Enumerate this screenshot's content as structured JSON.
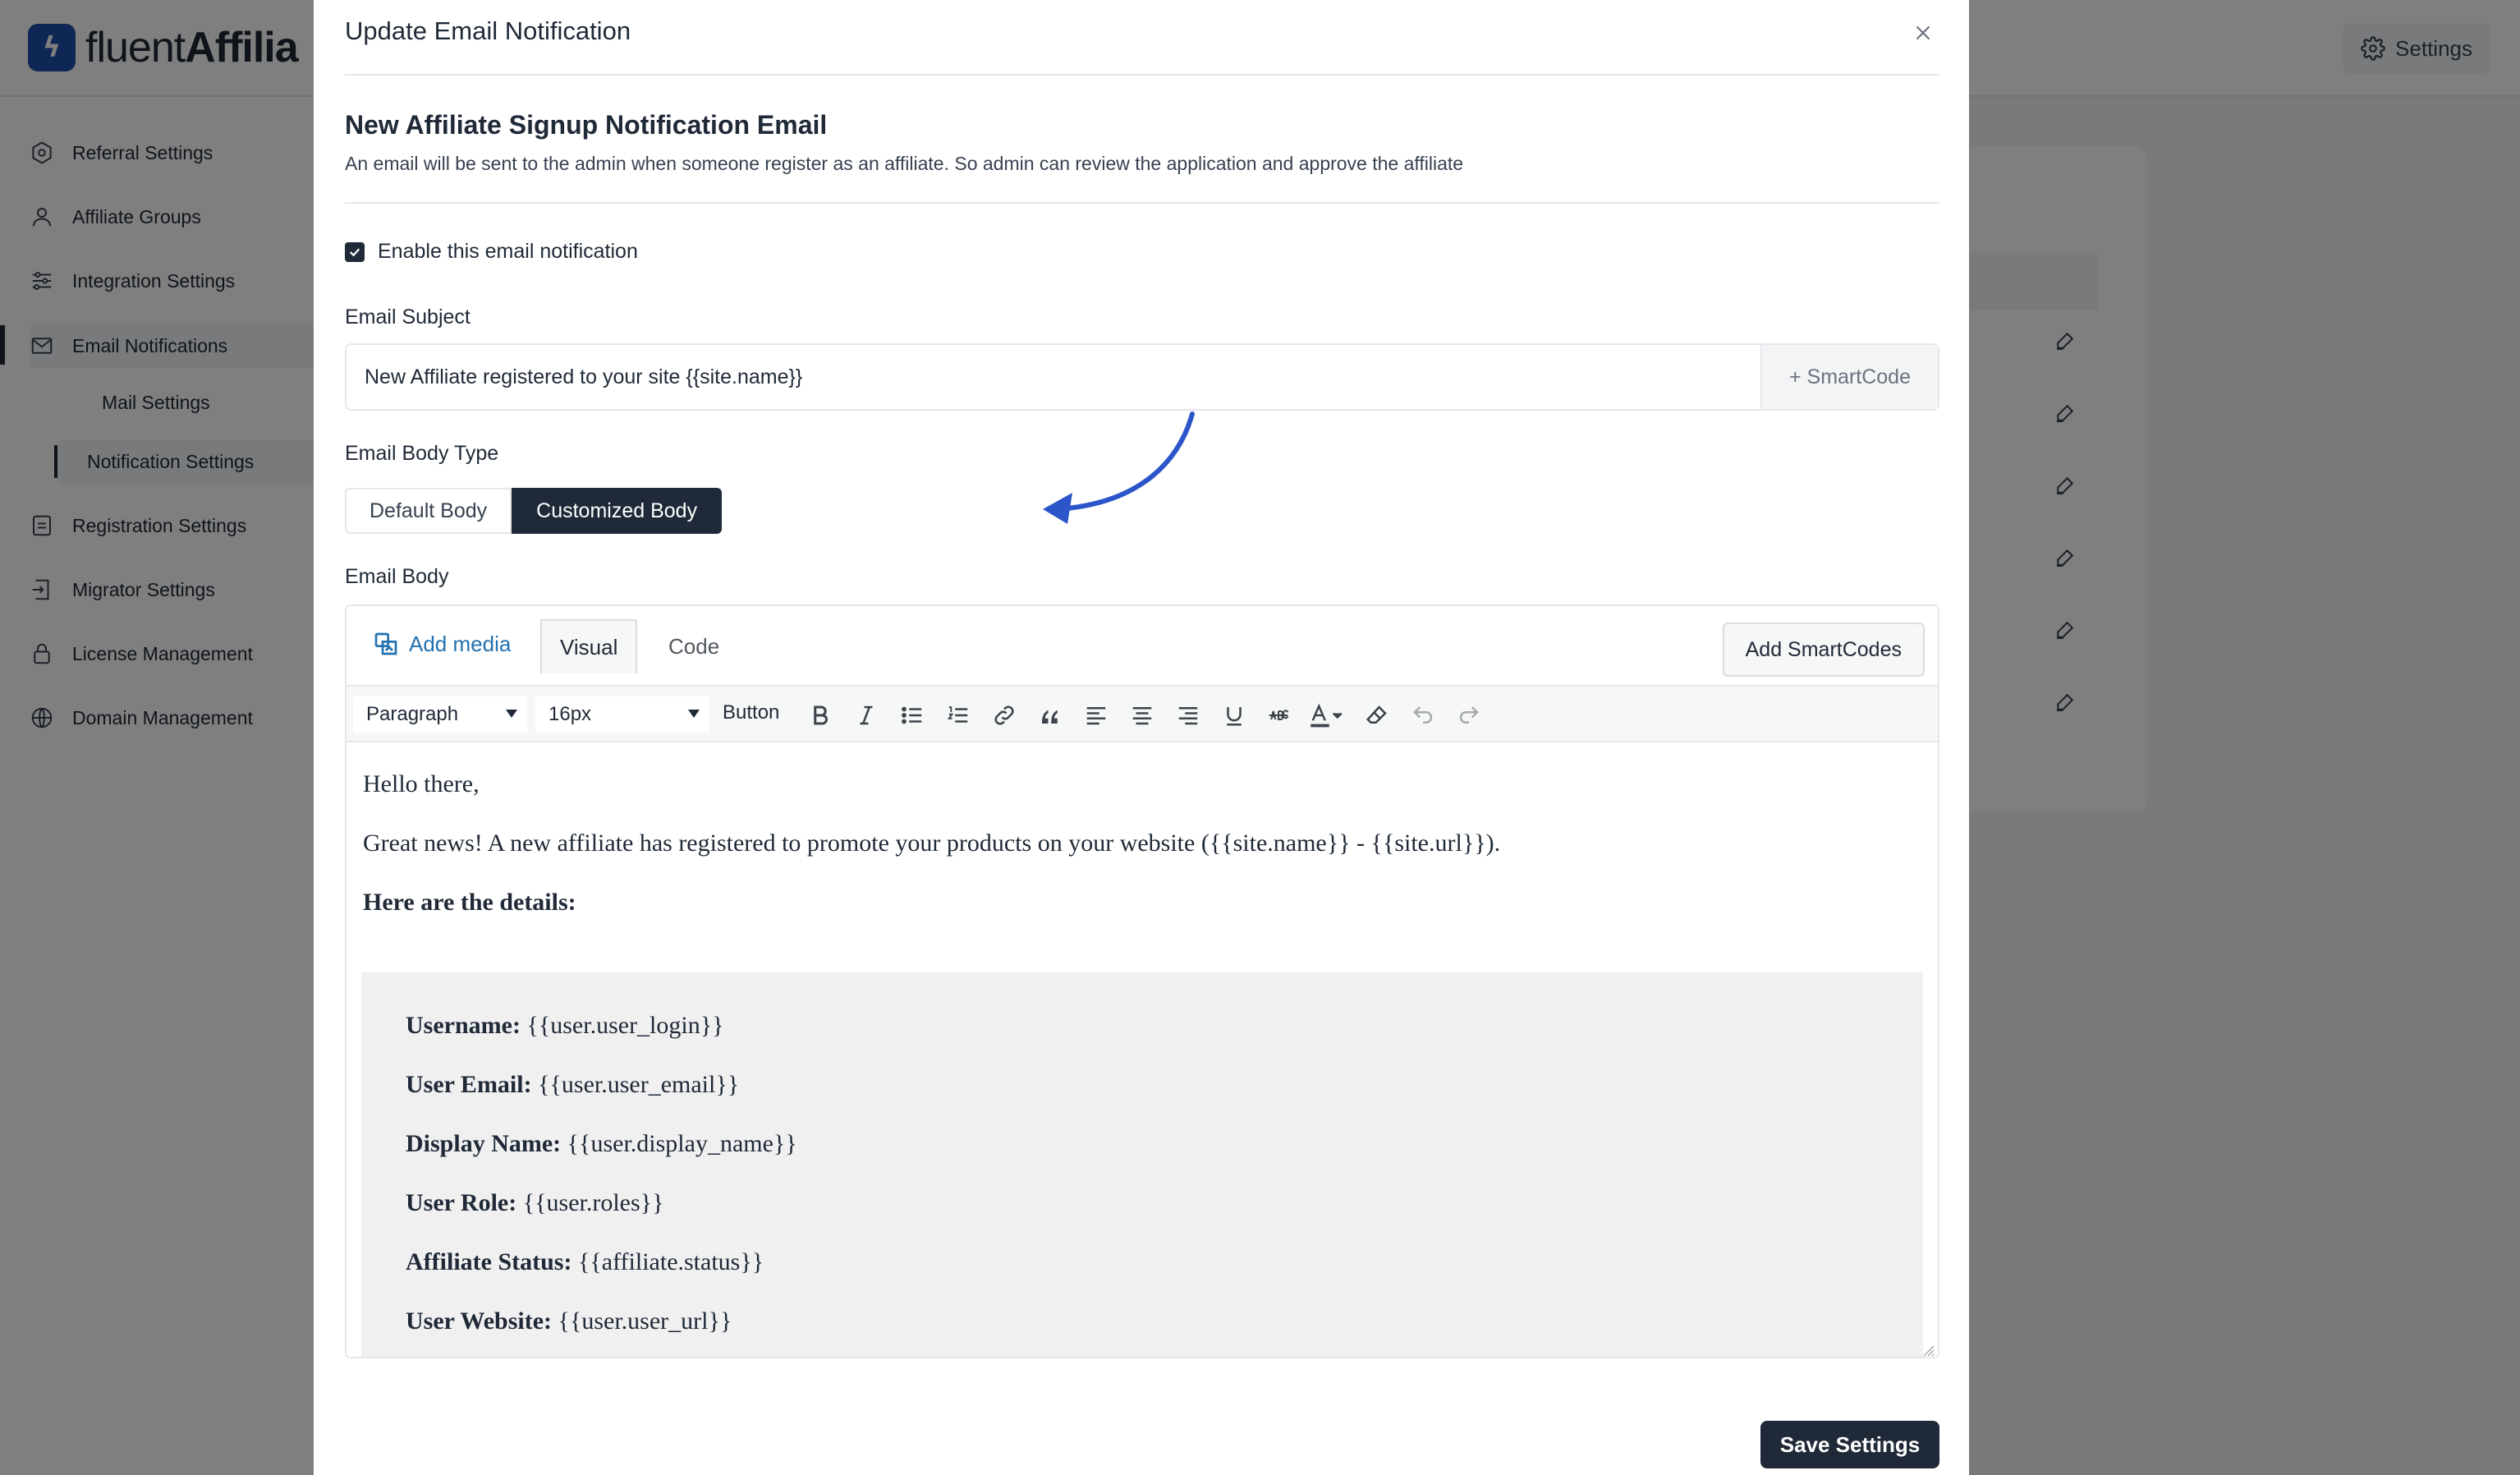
{
  "app": {
    "brand_light": "fluent",
    "brand_bold": "Affilia",
    "settings_label": "Settings"
  },
  "sidebar": {
    "items": [
      {
        "label": "Referral Settings",
        "icon": "gear-hex-icon"
      },
      {
        "label": "Affiliate Groups",
        "icon": "user-icon"
      },
      {
        "label": "Integration Settings",
        "icon": "sliders-icon"
      },
      {
        "label": "Email Notifications",
        "icon": "mail-icon"
      },
      {
        "label": "Mail Settings",
        "icon": ""
      },
      {
        "label": "Notification Settings",
        "icon": ""
      },
      {
        "label": "Registration Settings",
        "icon": "form-icon"
      },
      {
        "label": "Migrator Settings",
        "icon": "migrate-icon"
      },
      {
        "label": "License Management",
        "icon": "lock-icon"
      },
      {
        "label": "Domain Management",
        "icon": "globe-icon"
      }
    ]
  },
  "modal": {
    "title": "Update Email Notification",
    "section_title": "New Affiliate Signup Notification Email",
    "section_desc": "An email will be sent to the admin when someone register as an affiliate. So admin can review the application and approve the affiliate",
    "enable_label": "Enable this email notification",
    "enable_checked": true,
    "subject_label": "Email Subject",
    "subject_value": "New Affiliate registered to your site {{site.name}}",
    "smartcode_label": "+ SmartCode",
    "body_type_label": "Email Body Type",
    "body_types": [
      "Default Body",
      "Customized Body"
    ],
    "body_type_selected": "Customized Body",
    "body_label": "Email Body",
    "save_label": "Save Settings"
  },
  "editor": {
    "add_media": "Add media",
    "tab_visual": "Visual",
    "tab_code": "Code",
    "add_smartcodes": "Add SmartCodes",
    "format_value": "Paragraph",
    "size_value": "16px",
    "button_label": "Button",
    "content": {
      "greeting": "Hello there,",
      "intro": "Great news! A new affiliate has registered to promote your products on your website ({{site.name}} - {{site.url}}).",
      "details_heading": "Here are the details:",
      "details": [
        {
          "label": "Username:",
          "value": "{{user.user_login}}"
        },
        {
          "label": "User Email:",
          "value": "{{user.user_email}}"
        },
        {
          "label": "Display Name:",
          "value": "{{user.display_name}}"
        },
        {
          "label": "User Role:",
          "value": "{{user.roles}}"
        },
        {
          "label": "Affiliate Status:",
          "value": "{{affiliate.status}}"
        },
        {
          "label": "User Website:",
          "value": "{{user.user_url}}"
        }
      ]
    }
  },
  "colors": {
    "primary_dark": "#1f2937",
    "link_blue": "#2271b1",
    "arrow_blue": "#2b55c9",
    "brand_blue": "#1e4fa8"
  }
}
